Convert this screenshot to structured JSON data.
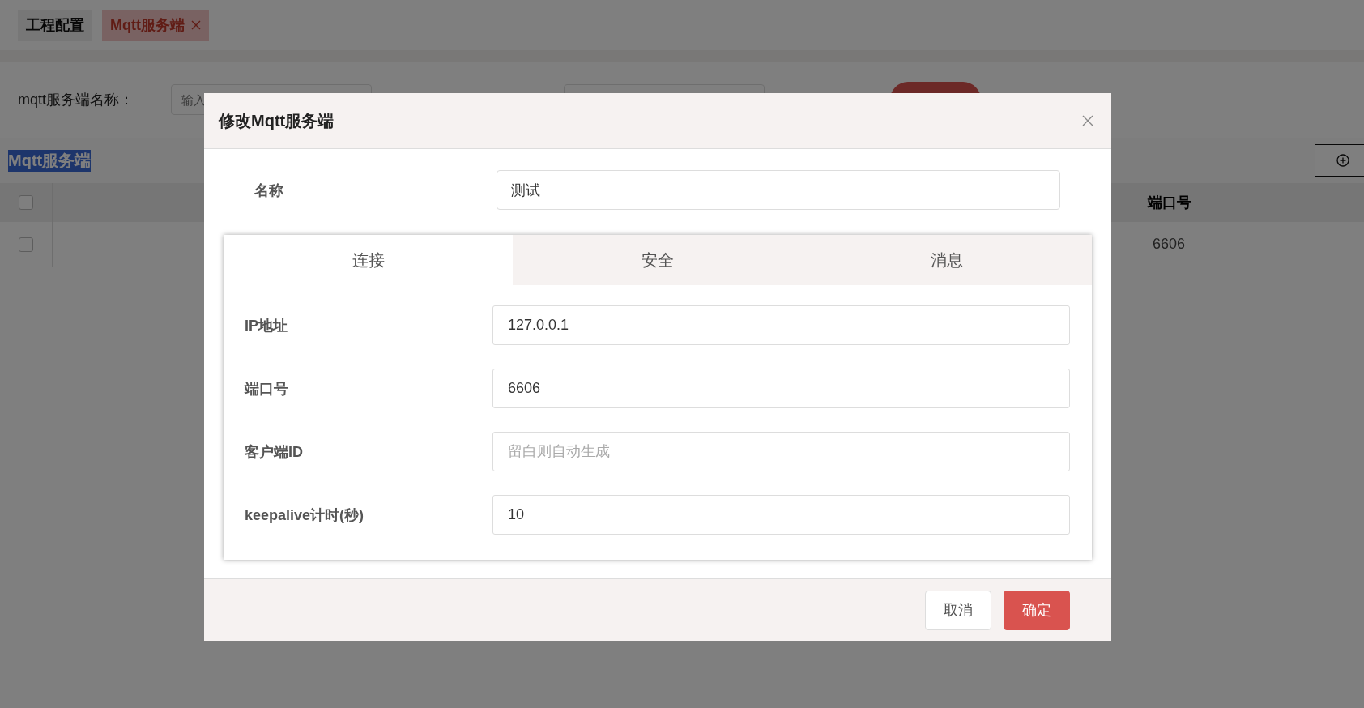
{
  "tabs": [
    {
      "label": "工程配置",
      "selected": false,
      "closable": false
    },
    {
      "label": "Mqtt服务端",
      "selected": true,
      "closable": true
    }
  ],
  "search": {
    "label": "mqtt服务端名称：",
    "placeholder": "输入"
  },
  "section_title": "Mqtt服务端",
  "table": {
    "header_checked": false,
    "columns": [
      "端口号"
    ],
    "rows": [
      {
        "checked": false,
        "cells": [
          "6606"
        ]
      }
    ]
  },
  "dialog": {
    "title": "修改Mqtt服务端",
    "name": {
      "label": "名称",
      "value": "测试"
    },
    "tabs": [
      {
        "label": "连接",
        "selected": true
      },
      {
        "label": "安全",
        "selected": false
      },
      {
        "label": "消息",
        "selected": false
      }
    ],
    "fields": [
      {
        "label": "IP地址",
        "value": "127.0.0.1"
      },
      {
        "label": "端口号",
        "value": "6606"
      },
      {
        "label": "客户端ID",
        "placeholder": "留白则自动生成"
      },
      {
        "label": "keepalive计时(秒)",
        "value": "10"
      }
    ],
    "buttons": [
      {
        "label": "取消",
        "kind": "default"
      },
      {
        "label": "确定",
        "kind": "primary"
      }
    ]
  }
}
